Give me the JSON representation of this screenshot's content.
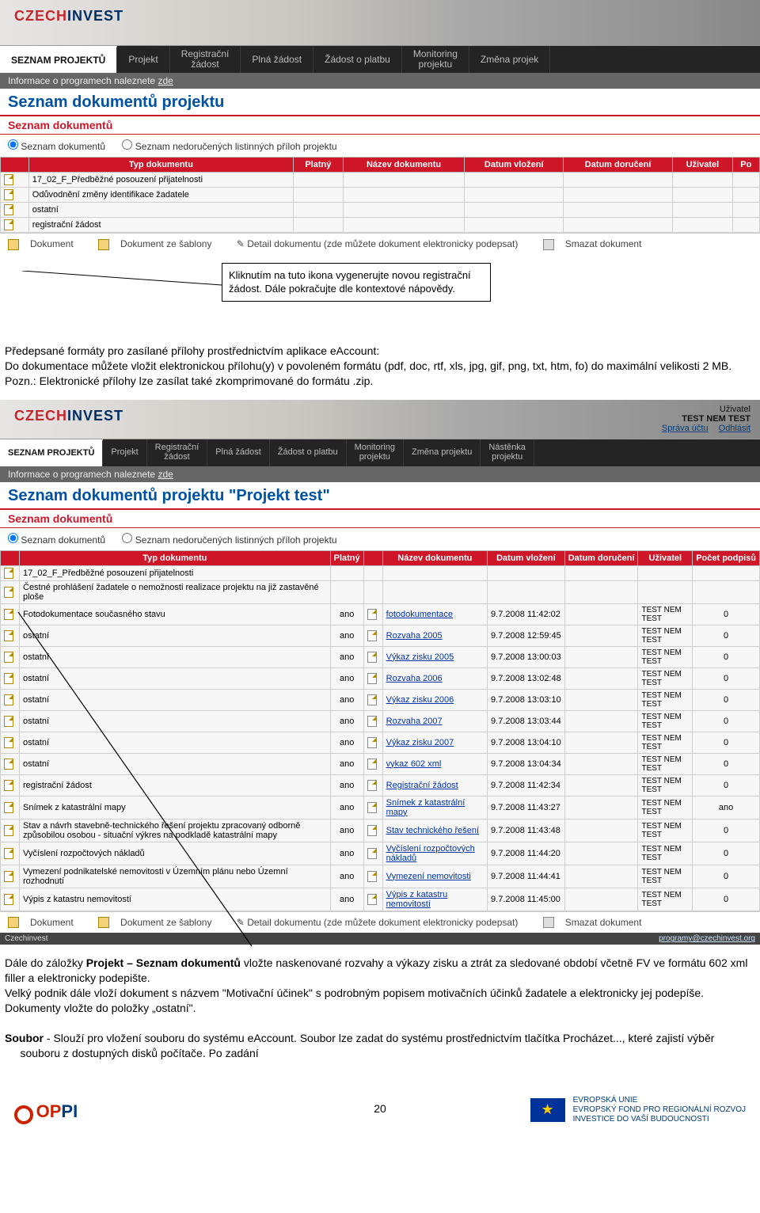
{
  "logo_red": "CZECH",
  "logo_blue": "INVEST",
  "nav1": {
    "items": [
      "SEZNAM PROJEKTŮ",
      "Projekt",
      "Registrační\nžádost",
      "Plná žádost",
      "Žádost o platbu",
      "Monitoring\nprojektu",
      "Změna projek"
    ]
  },
  "info_bar": "Informace o programech naleznete",
  "info_bar_link": "zde",
  "page_title1": "Seznam dokumentů projektu",
  "section_title": "Seznam dokumentů",
  "radio1": "Seznam dokumentů",
  "radio2": "Seznam nedoručených listinných příloh projektu",
  "table1": {
    "headers": [
      "",
      "Typ dokumentu",
      "Platný",
      "Název dokumentu",
      "Datum vložení",
      "Datum doručení",
      "Uživatel",
      "Po"
    ],
    "rows": [
      {
        "typ": "17_02_F_Předběžné posouzení přijatelnosti"
      },
      {
        "typ": "Odůvodnění změny identifikace žadatele"
      },
      {
        "typ": "ostatní"
      },
      {
        "typ": "registrační žádost"
      }
    ]
  },
  "actions": {
    "a1": "Dokument",
    "a2": "Dokument ze šablony",
    "a3": "Detail dokumentu (zde můžete dokument elektronicky podepsat)",
    "a4": "Smazat dokument"
  },
  "callout": "Kliknutím na tuto ikona vygenerujte novou registrační žádost. Dále pokračujte dle kontextové nápovědy.",
  "para1": "Předepsané formáty pro zasílané přílohy prostřednictvím aplikace eAccount:",
  "para2": "Do dokumentace můžete vložit elektronickou přílohu(y) v povoleném formátu (pdf, doc, rtf, xls, jpg, gif, png, txt, htm, fo) do maximální velikosti 2 MB.",
  "para3": "Pozn.: Elektronické přílohy lze zasílat také zkomprimované do formátu .zip.",
  "user_box": {
    "label": "Uživatel",
    "name": "TEST NEM TEST",
    "link1": "Správa účtu",
    "link2": "Odhlásit"
  },
  "nav2": {
    "items": [
      "SEZNAM PROJEKTŮ",
      "Projekt",
      "Registrační\nžádost",
      "Plná žádost",
      "Žádost o platbu",
      "Monitoring\nprojektu",
      "Změna projektu",
      "Nástěnka\nprojektu"
    ]
  },
  "page_title2": "Seznam dokumentů projektu  \"Projekt test\"",
  "table2": {
    "headers": [
      "",
      "Typ dokumentu",
      "Platný",
      "",
      "Název dokumentu",
      "Datum vložení",
      "Datum doručení",
      "Uživatel",
      "Počet podpisů"
    ],
    "rows": [
      {
        "typ": "17_02_F_Předběžné posouzení přijatelnosti",
        "platny": "",
        "nazev": "",
        "datum": "",
        "uziv": "",
        "pp": ""
      },
      {
        "typ": "Čestné prohlášení žadatele o nemožnosti realizace projektu na již zastavěné ploše",
        "platny": "",
        "nazev": "",
        "datum": "",
        "uziv": "",
        "pp": ""
      },
      {
        "typ": "Fotodokumentace současného stavu",
        "platny": "ano",
        "nazev": "fotodokumentace",
        "datum": "9.7.2008 11:42:02",
        "uziv": "TEST NEM TEST",
        "pp": "0"
      },
      {
        "typ": "ostatní",
        "platny": "ano",
        "nazev": "Rozvaha 2005",
        "datum": "9.7.2008 12:59:45",
        "uziv": "TEST NEM TEST",
        "pp": "0"
      },
      {
        "typ": "ostatní",
        "platny": "ano",
        "nazev": "Výkaz zisku 2005",
        "datum": "9.7.2008 13:00:03",
        "uziv": "TEST NEM TEST",
        "pp": "0"
      },
      {
        "typ": "ostatní",
        "platny": "ano",
        "nazev": "Rozvaha 2006",
        "datum": "9.7.2008 13:02:48",
        "uziv": "TEST NEM TEST",
        "pp": "0"
      },
      {
        "typ": "ostatní",
        "platny": "ano",
        "nazev": "Výkaz zisku 2006",
        "datum": "9.7.2008 13:03:10",
        "uziv": "TEST NEM TEST",
        "pp": "0"
      },
      {
        "typ": "ostatní",
        "platny": "ano",
        "nazev": "Rozvaha 2007",
        "datum": "9.7.2008 13:03:44",
        "uziv": "TEST NEM TEST",
        "pp": "0"
      },
      {
        "typ": "ostatní",
        "platny": "ano",
        "nazev": "Výkaz zisku 2007",
        "datum": "9.7.2008 13:04:10",
        "uziv": "TEST NEM TEST",
        "pp": "0"
      },
      {
        "typ": "ostatní",
        "platny": "ano",
        "nazev": "vykaz 602 xml",
        "datum": "9.7.2008 13:04:34",
        "uziv": "TEST NEM TEST",
        "pp": "0"
      },
      {
        "typ": "registrační žádost",
        "platny": "ano",
        "nazev": "Registrační žádost",
        "datum": "9.7.2008 11:42:34",
        "uziv": "TEST NEM TEST",
        "pp": "0"
      },
      {
        "typ": "Snímek z katastrální mapy",
        "platny": "ano",
        "nazev": "Snímek z katastrální mapy",
        "datum": "9.7.2008 11:43:27",
        "uziv": "TEST NEM TEST",
        "pp": "ano"
      },
      {
        "typ": "Stav a návrh stavebně-technického řešení projektu zpracovaný odborně způsobilou osobou - situační výkres na podkladě katastrální mapy",
        "platny": "ano",
        "nazev": "Stav technického řešení",
        "datum": "9.7.2008 11:43:48",
        "uziv": "TEST NEM TEST",
        "pp": "0"
      },
      {
        "typ": "Vyčíslení rozpočtových nákladů",
        "platny": "ano",
        "nazev": "Vyčíslení rozpočtových nákladů",
        "datum": "9.7.2008 11:44:20",
        "uziv": "TEST NEM TEST",
        "pp": "0"
      },
      {
        "typ": "Vymezení podnikatelské nemovitosti v Územním plánu nebo Územní rozhodnutí",
        "platny": "ano",
        "nazev": "Vymezení nemovitosti",
        "datum": "9.7.2008 11:44:41",
        "uziv": "TEST NEM TEST",
        "pp": "0"
      },
      {
        "typ": "Výpis z katastru nemovitostí",
        "platny": "ano",
        "nazev": "Výpis z katastru nemovitostí",
        "datum": "9.7.2008 11:45:00",
        "uziv": "TEST NEM TEST",
        "pp": "0"
      }
    ]
  },
  "foot_left": "Czechinvest",
  "foot_right": "programy@czechinvest.org",
  "para4_prefix": "Dále do záložky ",
  "para4_b1": "Projekt – Seznam dokumentů",
  "para4_mid": " vložte naskenované rozvahy a výkazy zisku a ztrát za sledované období včetně FV ve formátu 602 xml filler a elektronicky podepište.",
  "para5": "Velký podnik dále vloží dokument s názvem \"Motivační účinek\" s podrobným popisem motivačních účinků žadatele a elektronicky jej podepíše.",
  "para6": "Dokumenty vložte do položky „ostatní\".",
  "para7_a": "Soubor",
  "para7_b": " - Slouží pro vložení souboru do systému eAccount. Soubor lze zadat do systému prostřednictvím tlačítka  Procházet..., které zajistí výběr",
  "para7_c": "souboru z dostupných disků počítače. Po zadání",
  "pagenum": "20",
  "oppi": "OPPI",
  "eu1": "EVROPSKÁ UNIE",
  "eu2": "EVROPSKÝ FOND PRO REGIONÁLNÍ ROZVOJ",
  "eu3": "INVESTICE DO VAŠÍ BUDOUCNOSTI"
}
